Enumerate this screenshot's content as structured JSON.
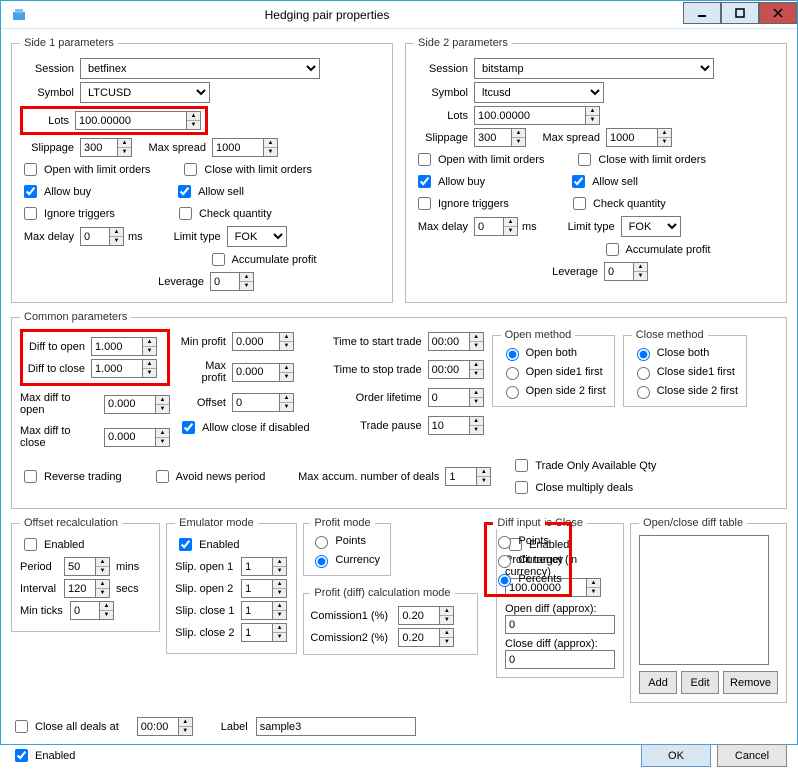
{
  "window": {
    "title": "Hedging pair properties"
  },
  "side1": {
    "legend": "Side 1 parameters",
    "session_lbl": "Session",
    "session": "betfinex",
    "symbol_lbl": "Symbol",
    "symbol": "LTCUSD",
    "lots_lbl": "Lots",
    "lots": "100.00000",
    "slippage_lbl": "Slippage",
    "slippage": "300",
    "maxspread_lbl": "Max spread",
    "maxspread": "1000",
    "open_limit": "Open with limit orders",
    "close_limit": "Close with limit orders",
    "allow_buy": "Allow buy",
    "allow_sell": "Allow sell",
    "ignore_triggers": "Ignore triggers",
    "check_qty": "Check quantity",
    "maxdelay_lbl": "Max delay",
    "maxdelay": "0",
    "ms": "ms",
    "limittype_lbl": "Limit type",
    "limittype": "FOK",
    "accum": "Accumulate profit",
    "leverage_lbl": "Leverage",
    "leverage": "0"
  },
  "side2": {
    "legend": "Side 2 parameters",
    "session_lbl": "Session",
    "session": "bitstamp",
    "symbol_lbl": "Symbol",
    "symbol": "ltcusd",
    "lots_lbl": "Lots",
    "lots": "100.00000",
    "slippage_lbl": "Slippage",
    "slippage": "300",
    "maxspread_lbl": "Max spread",
    "maxspread": "1000",
    "open_limit": "Open with limit orders",
    "close_limit": "Close with limit orders",
    "allow_buy": "Allow buy",
    "allow_sell": "Allow sell",
    "ignore_triggers": "Ignore triggers",
    "check_qty": "Check quantity",
    "maxdelay_lbl": "Max delay",
    "maxdelay": "0",
    "ms": "ms",
    "limittype_lbl": "Limit type",
    "limittype": "FOK",
    "accum": "Accumulate profit",
    "leverage_lbl": "Leverage",
    "leverage": "0"
  },
  "common": {
    "legend": "Common parameters",
    "diff_open_lbl": "Diff to open",
    "diff_open": "1.000",
    "diff_close_lbl": "Diff to close",
    "diff_close": "1.000",
    "max_diff_open_lbl": "Max diff to open",
    "max_diff_open": "0.000",
    "max_diff_close_lbl": "Max diff to close",
    "max_diff_close": "0.000",
    "min_profit_lbl": "Min profit",
    "min_profit": "0.000",
    "max_profit_lbl": "Max profit",
    "max_profit": "0.000",
    "offset_lbl": "Offset",
    "offset": "0",
    "allow_close_disabled": "Allow close if disabled",
    "time_start_lbl": "Time to start trade",
    "time_start": "00:00",
    "time_stop_lbl": "Time to stop trade",
    "time_stop": "00:00",
    "order_life_lbl": "Order lifetime",
    "order_life": "0",
    "trade_pause_lbl": "Trade pause",
    "trade_pause": "10",
    "reverse": "Reverse trading",
    "avoid_news": "Avoid news period",
    "max_accum_lbl": "Max accum. number of deals",
    "max_accum": "1",
    "open_method": "Open method",
    "open_both": "Open both",
    "open_s1": "Open side1 first",
    "open_s2": "Open side 2 first",
    "close_method": "Close method",
    "close_both": "Close both",
    "close_s1": "Close side1 first",
    "close_s2": "Close side 2 first",
    "trade_only": "Trade Only Available Qty",
    "close_mult": "Close multiply deals"
  },
  "offset": {
    "legend": "Offset recalculation",
    "enabled": "Enabled",
    "period_lbl": "Period",
    "period": "50",
    "mins": "mins",
    "interval_lbl": "Interval",
    "interval": "120",
    "secs": "secs",
    "minticks_lbl": "Min ticks",
    "minticks": "0"
  },
  "emulator": {
    "legend": "Emulator mode",
    "enabled": "Enabled",
    "so1_lbl": "Slip. open 1",
    "so1": "1",
    "so2_lbl": "Slip. open 2",
    "so2": "1",
    "sc1_lbl": "Slip. close 1",
    "sc1": "1",
    "sc2_lbl": "Slip. close 2",
    "sc2": "1"
  },
  "profit_mode": {
    "legend": "Profit mode",
    "points": "Points",
    "currency": "Currency"
  },
  "diff_input": {
    "legend": "Diff input",
    "points": "Points",
    "currency": "Currency",
    "percents": "Percents"
  },
  "calc": {
    "legend": "Profit (diff) calculation mode",
    "c1_lbl": "Comission1 (%)",
    "c1": "0.20",
    "c2_lbl": "Comission2 (%)",
    "c2": "0.20"
  },
  "dyn": {
    "legend": "Dynamic Close",
    "enabled": "Enabled",
    "target_lbl": "Profit target (in currency)",
    "target": "100.00000",
    "opend_lbl": "Open diff (approx):",
    "opend": "0",
    "closed_lbl": "Close diff (approx):",
    "closed": "0"
  },
  "table": {
    "legend": "Open/close diff table",
    "add": "Add",
    "edit": "Edit",
    "remove": "Remove"
  },
  "footer": {
    "close_all": "Close all deals at",
    "close_time": "00:00",
    "label_lbl": "Label",
    "label": "sample3",
    "enabled": "Enabled",
    "ok": "OK",
    "cancel": "Cancel"
  }
}
